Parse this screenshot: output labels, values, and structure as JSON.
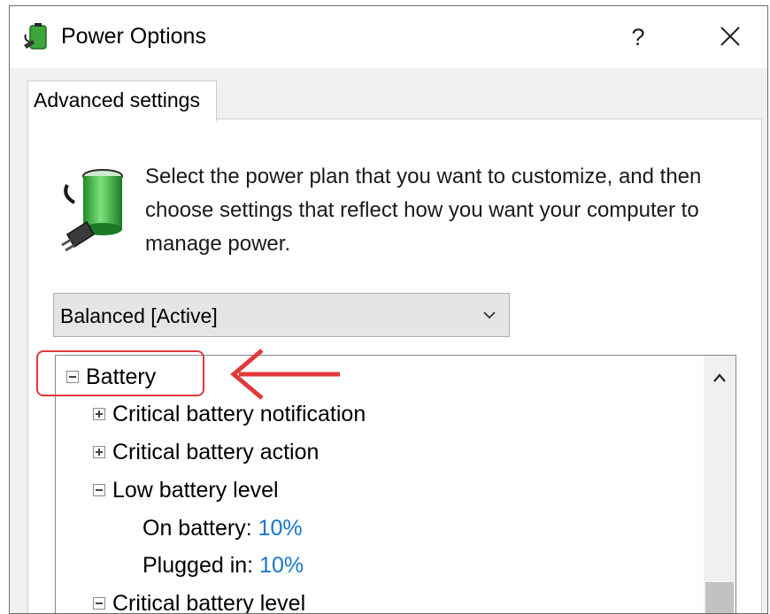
{
  "window": {
    "title": "Power Options",
    "help_label": "?",
    "icons": {
      "app": "power-options-icon",
      "close": "close-icon"
    }
  },
  "tabs": [
    {
      "label": "Advanced settings",
      "selected": true
    }
  ],
  "description": "Select the power plan that you want to customize, and then choose settings that reflect how you want your computer to manage power.",
  "plan_select": {
    "value": "Balanced [Active]",
    "icon": "chevron-down-icon"
  },
  "tree": {
    "items": [
      {
        "label": "Battery",
        "expander": "minus",
        "level": 0
      },
      {
        "label": "Critical battery notification",
        "expander": "plus",
        "level": 1
      },
      {
        "label": "Critical battery action",
        "expander": "plus",
        "level": 1
      },
      {
        "label": "Low battery level",
        "expander": "minus",
        "level": 1
      },
      {
        "label": "On battery:",
        "value": "10%",
        "level": 2
      },
      {
        "label": "Plugged in:",
        "value": "10%",
        "level": 2
      },
      {
        "label": "Critical battery level",
        "expander": "minus",
        "level": 1
      }
    ],
    "scroll_up_icon": "chevron-up-icon"
  },
  "annotation": {
    "highlight_target": "Battery",
    "color": "#e03a3a",
    "icon": "arrow-left-icon"
  },
  "colors": {
    "value_text": "#1a77c9",
    "select_bg": "#e5e5e5"
  }
}
